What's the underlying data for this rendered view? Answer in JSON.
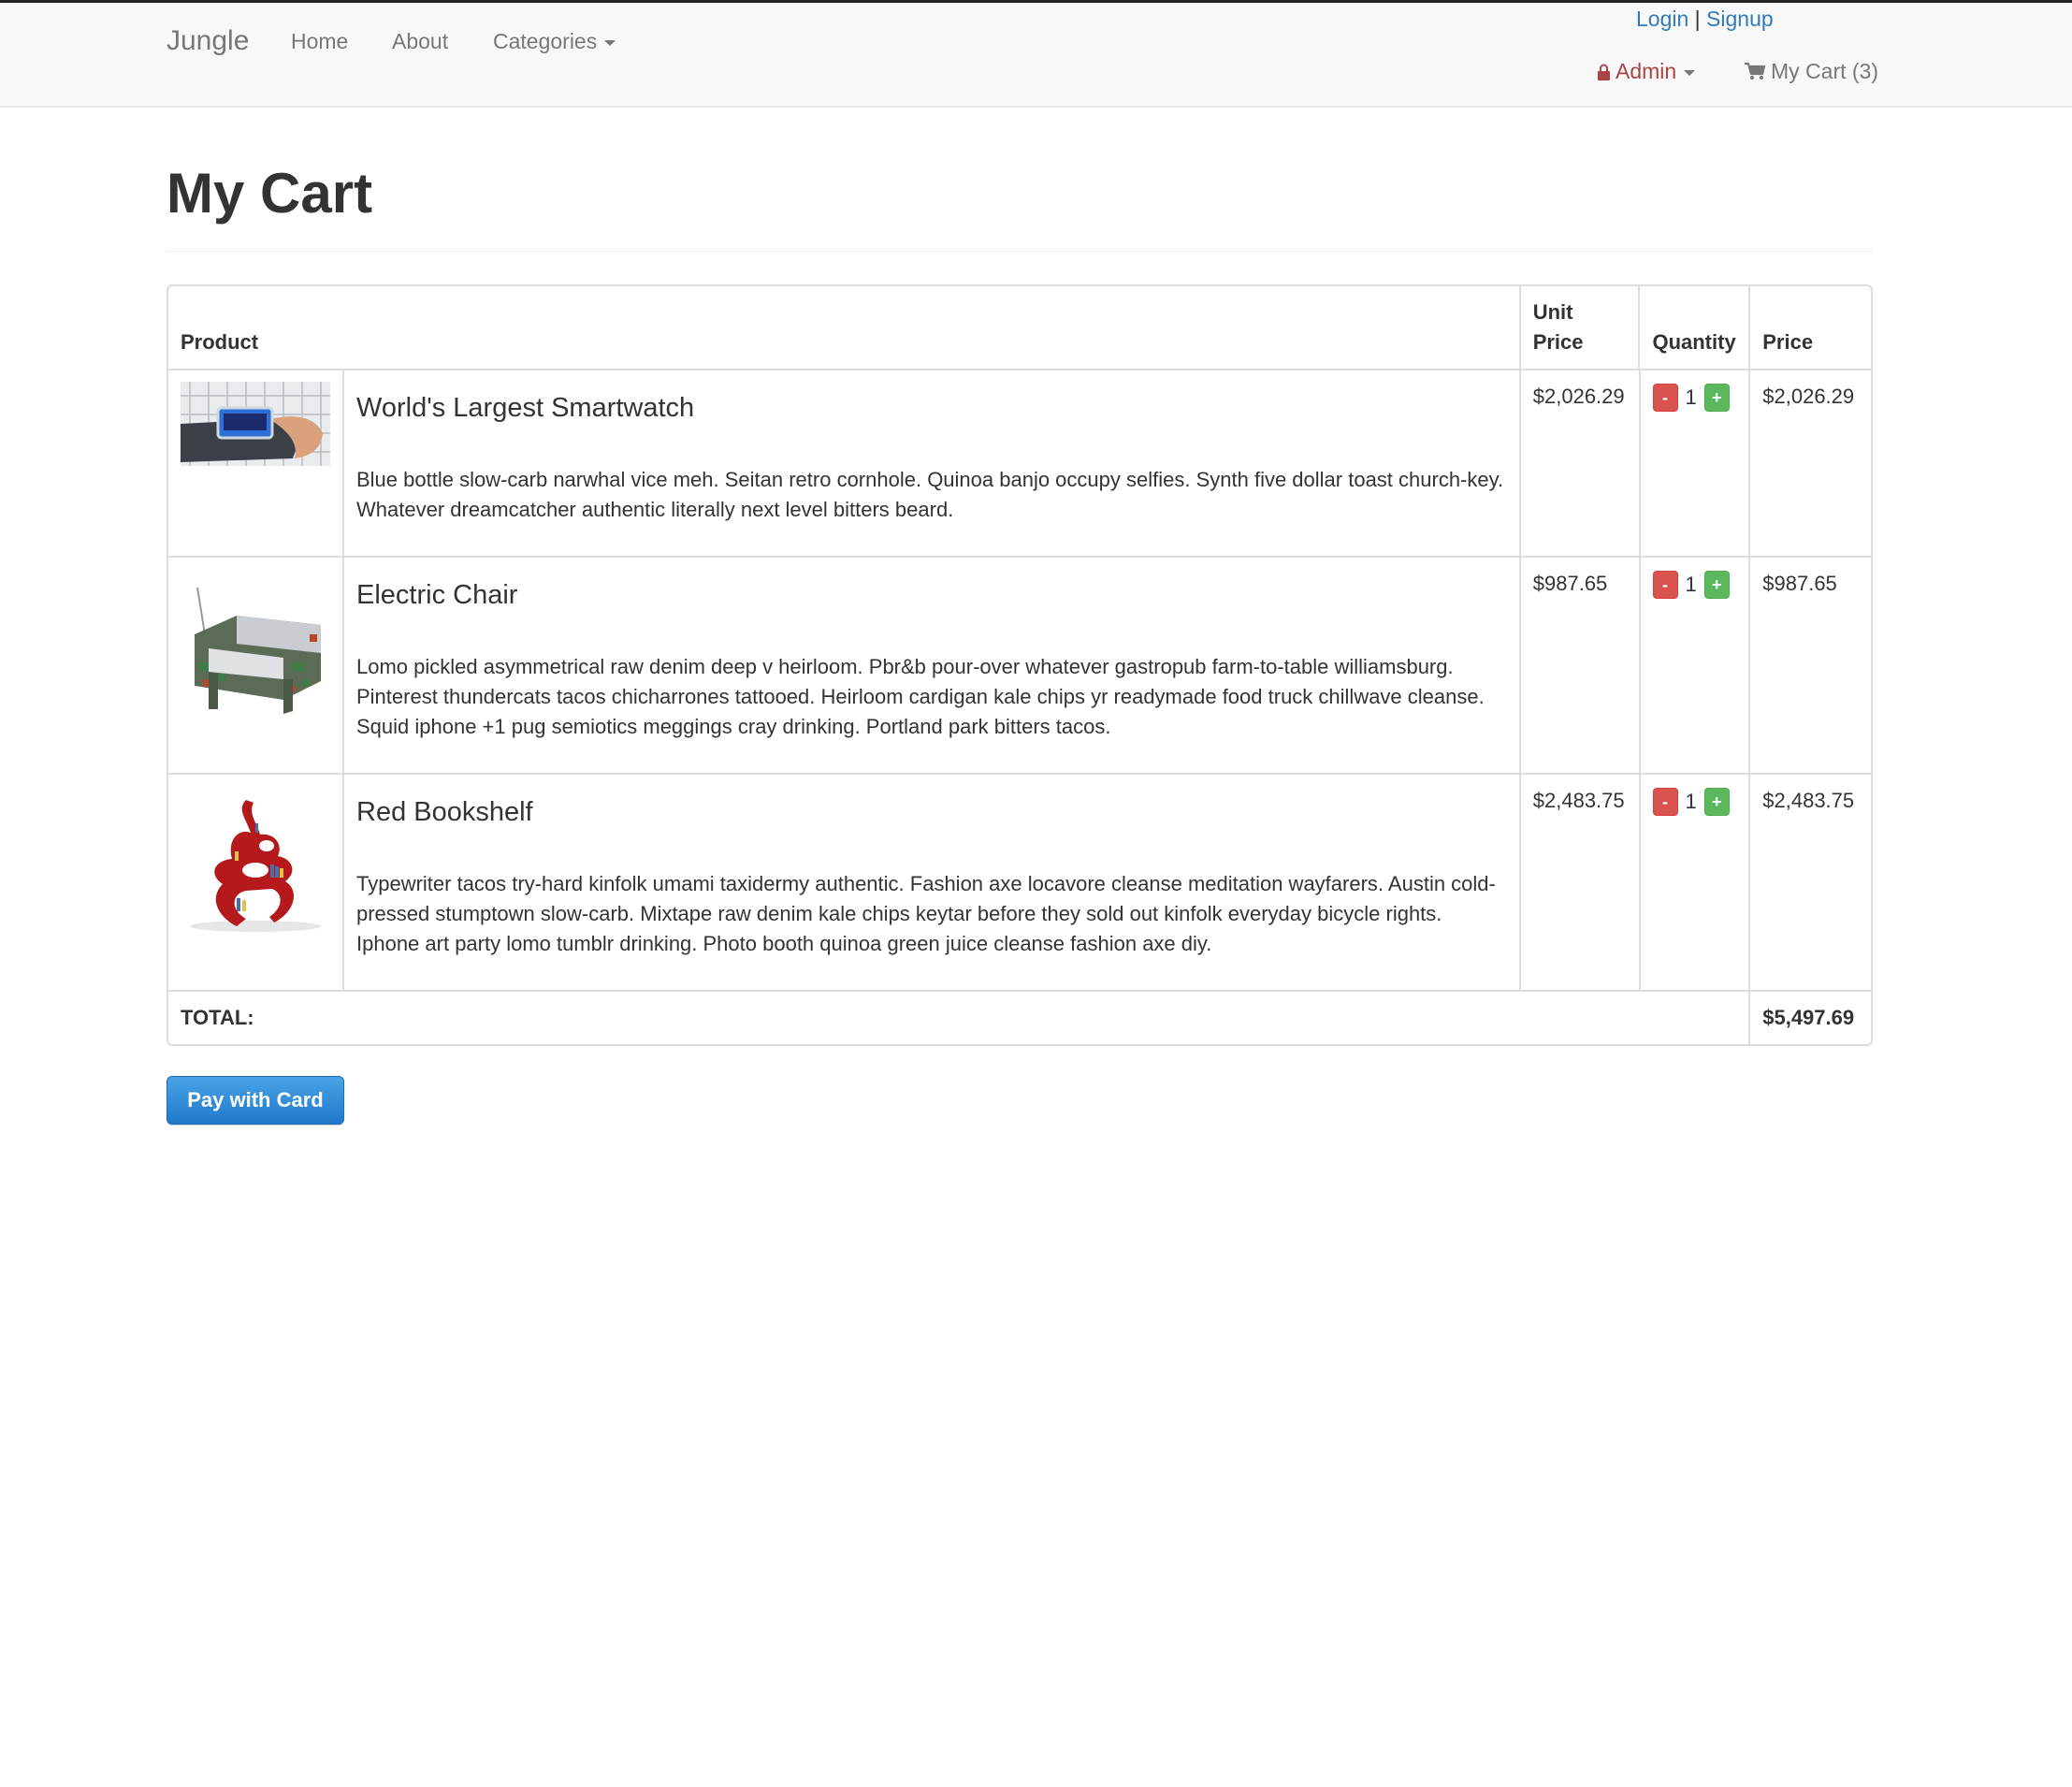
{
  "nav": {
    "brand": "Jungle",
    "links": [
      "Home",
      "About",
      "Categories"
    ],
    "login": "Login",
    "separator": "|",
    "signup": "Signup",
    "admin": "Admin",
    "cart": "My Cart (3)"
  },
  "page": {
    "title": "My Cart"
  },
  "table": {
    "headers": {
      "product": "Product",
      "unit_price": "Unit Price",
      "quantity": "Quantity",
      "price": "Price"
    },
    "items": [
      {
        "name": "World's Largest Smartwatch",
        "description": "Blue bottle slow-carb narwhal vice meh. Seitan retro cornhole. Quinoa banjo occupy selfies. Synth five dollar toast church-key. Whatever dreamcatcher authentic literally next level bitters beard.",
        "unit_price": "$2,026.29",
        "quantity": "1",
        "price": "$2,026.29"
      },
      {
        "name": "Electric Chair",
        "description": "Lomo pickled asymmetrical raw denim deep v heirloom. Pbr&b pour-over whatever gastropub farm-to-table williamsburg. Pinterest thundercats tacos chicharrones tattooed. Heirloom cardigan kale chips yr readymade food truck chillwave cleanse. Squid iphone +1 pug semiotics meggings cray drinking. Portland park bitters tacos.",
        "unit_price": "$987.65",
        "quantity": "1",
        "price": "$987.65"
      },
      {
        "name": "Red Bookshelf",
        "description": "Typewriter tacos try-hard kinfolk umami taxidermy authentic. Fashion axe locavore cleanse meditation wayfarers. Austin cold-pressed stumptown slow-carb. Mixtape raw denim kale chips keytar before they sold out kinfolk everyday bicycle rights. Iphone art party lomo tumblr drinking. Photo booth quinoa green juice cleanse fashion axe diy.",
        "unit_price": "$2,483.75",
        "quantity": "1",
        "price": "$2,483.75"
      }
    ],
    "minus_label": "-",
    "plus_label": "+",
    "total_label": "TOTAL:",
    "total_value": "$5,497.69"
  },
  "pay_button": "Pay with Card",
  "colors": {
    "link": "#337ab7",
    "admin": "#a94442",
    "minus": "#d9534f",
    "plus": "#5cb85c",
    "pay": "#2a88d8"
  }
}
